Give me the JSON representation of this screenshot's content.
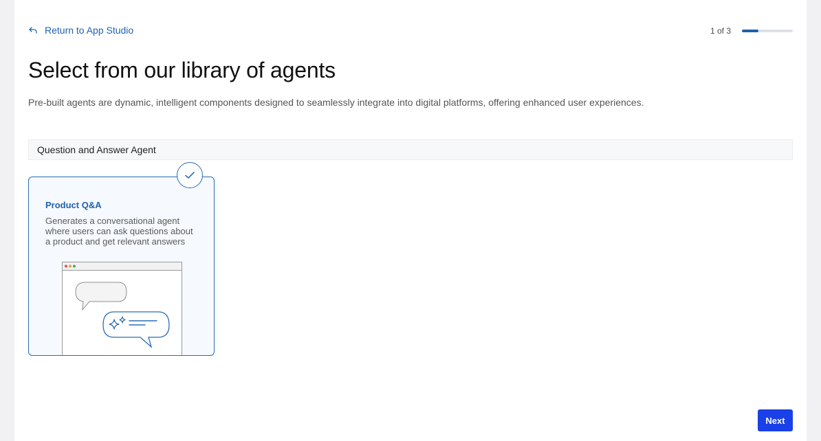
{
  "nav": {
    "back_label": "Return to App Studio"
  },
  "progress": {
    "label": "1 of 3",
    "step": 1,
    "total": 3,
    "fraction": 0.33
  },
  "page": {
    "title": "Select from our library of agents",
    "subtitle": "Pre-built agents are dynamic, intelligent components designed to seamlessly integrate into digital platforms, offering enhanced user experiences."
  },
  "section": {
    "label": "Question and Answer Agent"
  },
  "cards": [
    {
      "title": "Product Q&A",
      "description": "Generates a conversational agent where users can ask questions about a product and get relevant answers",
      "selected": true
    }
  ],
  "actions": {
    "next_label": "Next"
  },
  "colors": {
    "accent": "#1f61b0",
    "primary_button": "#1a40e8",
    "card_border": "#2c6bb3",
    "progress_fill": "#1f5fab"
  },
  "icons": {
    "back": "return-arrow-icon",
    "check": "check-icon",
    "sparkle": "sparkle-icon"
  }
}
